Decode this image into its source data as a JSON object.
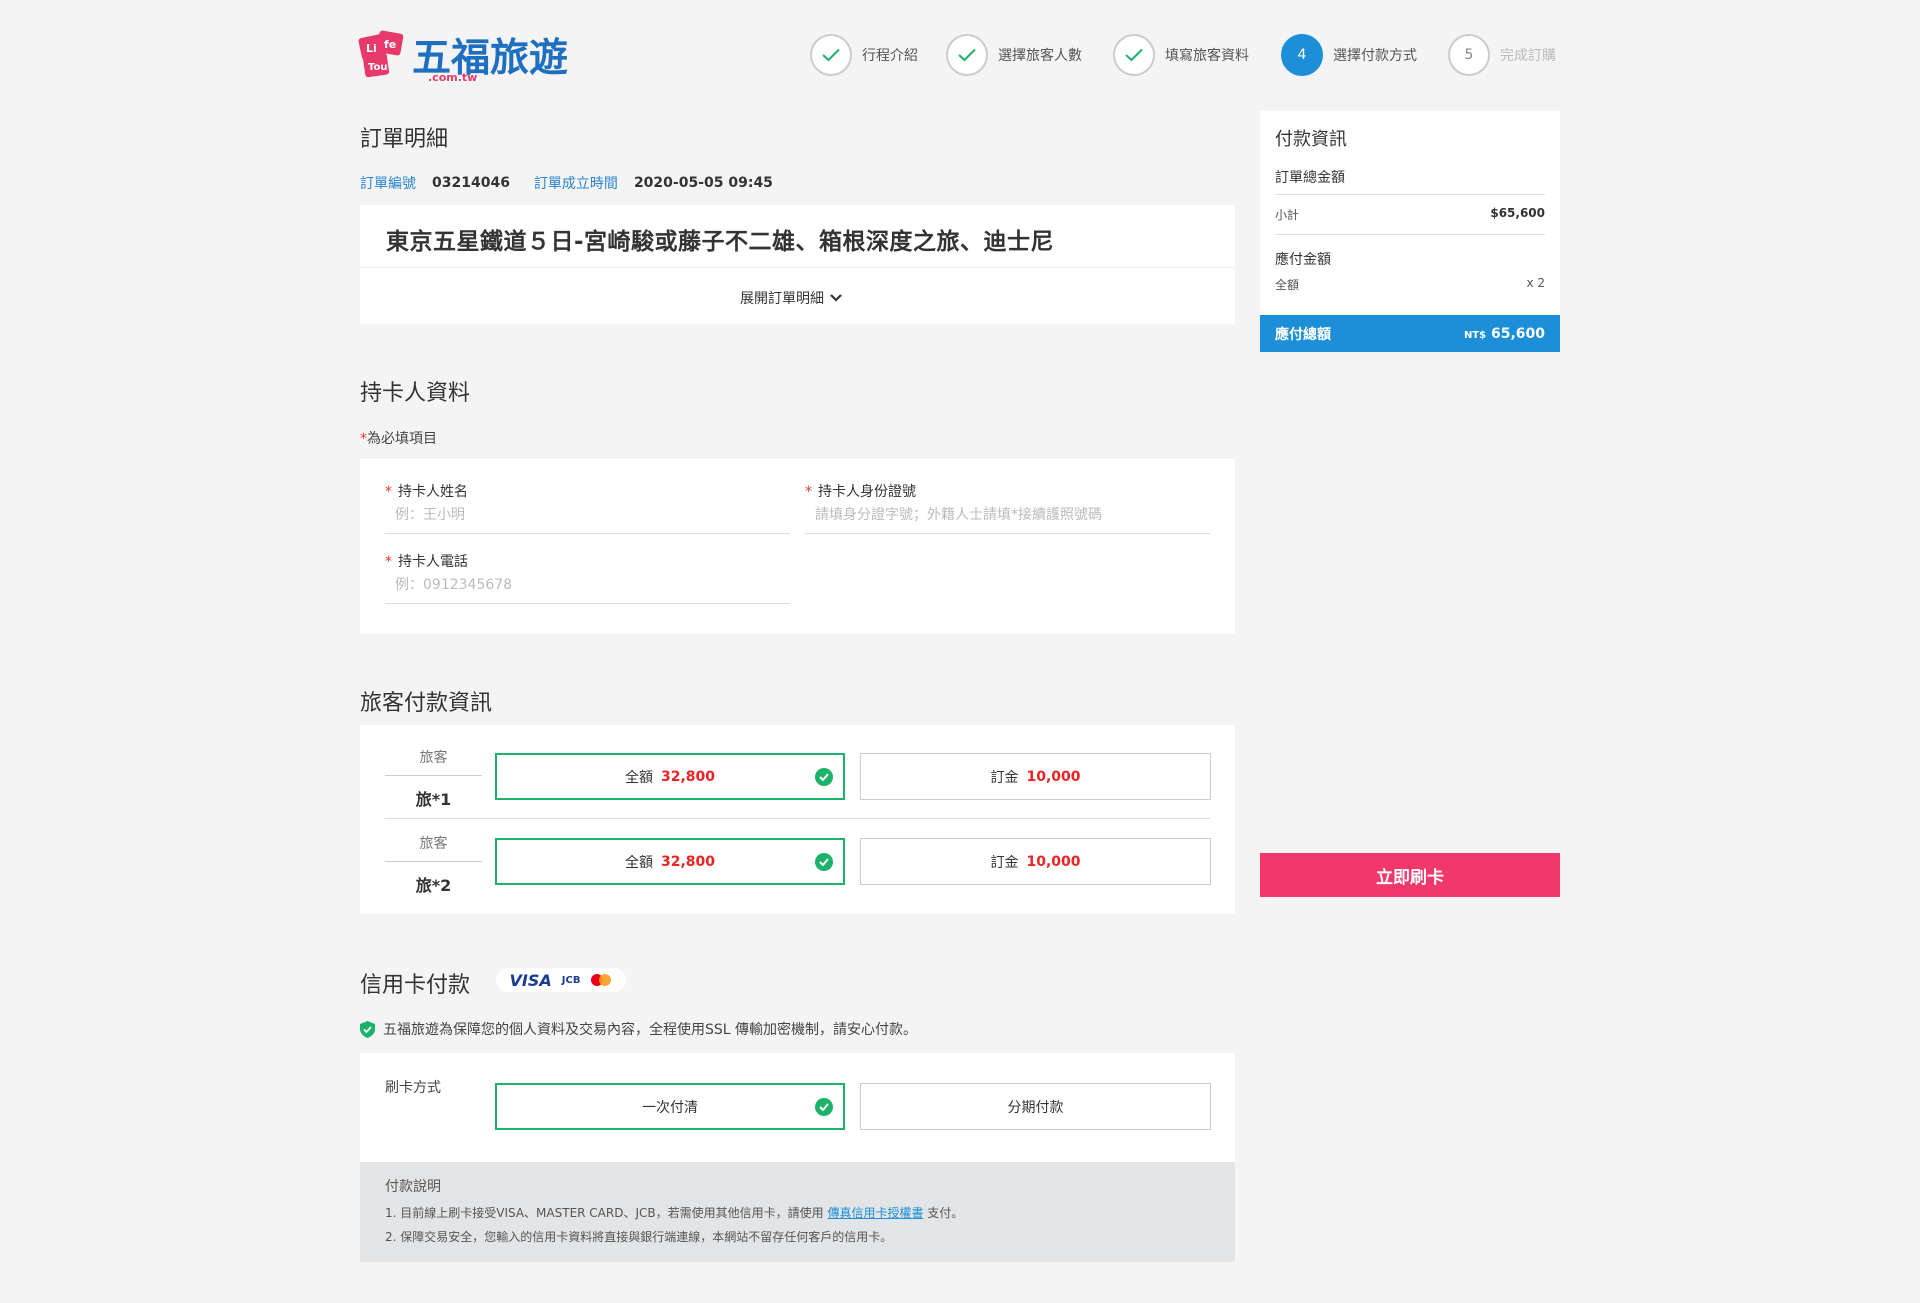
{
  "brand": {
    "name": "五福旅遊",
    "domain": ".com.tw",
    "badge": "Life Tour",
    "color": "#1e6fc0"
  },
  "steps": [
    {
      "num": "1",
      "label": "行程介紹",
      "state": "done"
    },
    {
      "num": "2",
      "label": "選擇旅客人數",
      "state": "done"
    },
    {
      "num": "3",
      "label": "填寫旅客資料",
      "state": "done"
    },
    {
      "num": "4",
      "label": "選擇付款方式",
      "state": "active"
    },
    {
      "num": "5",
      "label": "完成訂購",
      "state": "todo"
    }
  ],
  "order": {
    "heading": "訂單明細",
    "number_label": "訂單編號",
    "number": "03214046",
    "created_label": "訂單成立時間",
    "created": "2020-05-05 09:45",
    "tour_title": "東京五星鐵道５日-宮崎駿或藤子不二雄、箱根深度之旅、迪士尼",
    "expand_label": "展開訂單明細"
  },
  "cardholder": {
    "heading": "持卡人資料",
    "required_note": "為必填項目",
    "name_label": "持卡人姓名",
    "name_placeholder": "例：王小明",
    "id_label": "持卡人身份證號",
    "id_placeholder": "請填身分證字號；外籍人士請填*接續護照號碼",
    "phone_label": "持卡人電話",
    "phone_placeholder": "例：0912345678"
  },
  "traveler_payment": {
    "heading": "旅客付款資訊",
    "rows": [
      {
        "label": "旅客",
        "name": "旅*1",
        "full_label": "全額",
        "full_amount": "32,800",
        "deposit_label": "訂金",
        "deposit_amount": "10,000",
        "selected": "full"
      },
      {
        "label": "旅客",
        "name": "旅*2",
        "full_label": "全額",
        "full_amount": "32,800",
        "deposit_label": "訂金",
        "deposit_amount": "10,000",
        "selected": "full"
      }
    ]
  },
  "credit": {
    "heading": "信用卡付款",
    "card_brands": {
      "visa": "VISA",
      "jcb": "JCB"
    },
    "secure_note": "五福旅遊為保障您的個人資料及交易內容，全程使用SSL 傳輸加密機制，請安心付款。",
    "method_label": "刷卡方式",
    "method_once": "一次付清",
    "method_installment": "分期付款",
    "selected": "once"
  },
  "notes": {
    "title": "付款說明",
    "line1_prefix": "1.  目前線上刷卡接受VISA、MASTER CARD、JCB，若需使用其他信用卡，請使用",
    "line1_link": "傳真信用卡授權書",
    "line1_suffix": "支付。",
    "line2": "2.  保障交易安全，您輸入的信用卡資料將直接與銀行端連線，本網站不留存任何客戶的信用卡。"
  },
  "summary": {
    "title": "付款資訊",
    "total_heading": "訂單總金額",
    "subtotal_label": "小計",
    "subtotal_value": "$65,600",
    "payable_heading": "應付金額",
    "full_label": "全額",
    "full_qty": "x 2",
    "grand_label": "應付總額",
    "grand_currency": "NT$",
    "grand_value": "65,600"
  },
  "pay_button": "立即刷卡",
  "colors": {
    "accent": "#1c8fd8",
    "selected": "#1bb36a",
    "pay": "#f2376b",
    "amount": "#e22222"
  }
}
